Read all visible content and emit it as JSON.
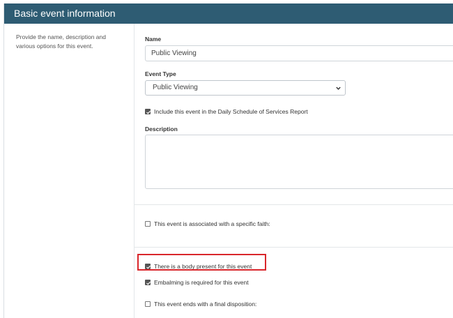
{
  "header": {
    "title": "Basic event information"
  },
  "sidebar": {
    "description": "Provide the name, description and various options for this event."
  },
  "form": {
    "name_label": "Name",
    "name_value": "Public Viewing",
    "event_type_label": "Event Type",
    "event_type_value": "Public Viewing",
    "include_schedule": {
      "label": "Include this event in the Daily Schedule of Services Report",
      "checked": true
    },
    "description_label": "Description",
    "description_value": "",
    "specific_faith": {
      "label": "This event is associated with a specific faith:",
      "checked": false
    },
    "body_present": {
      "label": "There is a body present for this event",
      "checked": true
    },
    "embalming_required": {
      "label": "Embalming is required for this event",
      "checked": true
    },
    "final_disposition": {
      "label": "This event ends with a final disposition:",
      "checked": false
    }
  },
  "colors": {
    "header_bg": "#2e5c73",
    "highlight_border": "#d9262b"
  }
}
